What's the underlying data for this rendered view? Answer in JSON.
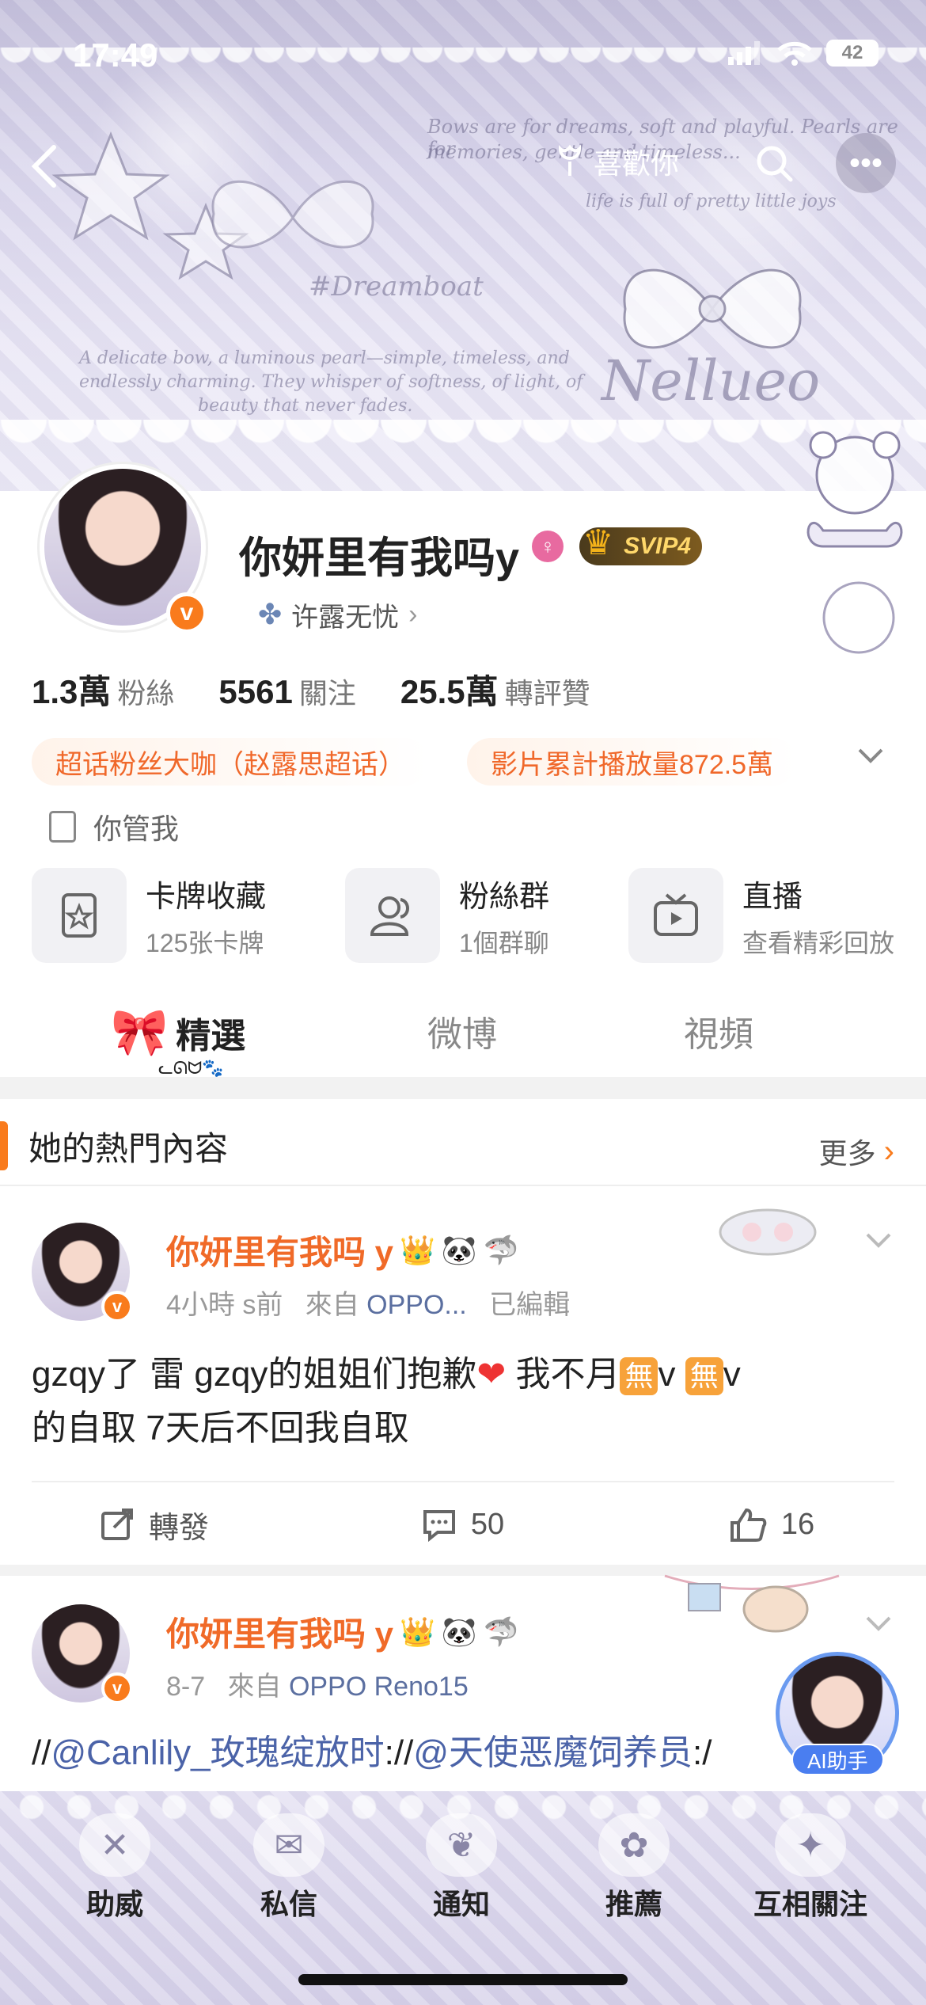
{
  "status_bar": {
    "time": "17:49",
    "battery": "42"
  },
  "header": {
    "like_label": "喜歡你",
    "deco_hashtag": "#Dreamboat",
    "deco_brand": "Nellueo",
    "deco_line1": "Bows are for dreams, soft and playful. Pearls are for",
    "deco_line2": "memories, gentle and timeless...",
    "deco_line3": "life is full of pretty little joys",
    "deco_line4": "A delicate bow, a luminous pearl—simple, timeless, and",
    "deco_line5": "endlessly charming. They whisper of softness, of light, of",
    "deco_line6": "beauty that never fades."
  },
  "profile": {
    "username": "你妍里有我吗y",
    "verified_badge": "v",
    "vip_label": "SVIP4",
    "fan_group": "许露无忧",
    "stats": [
      {
        "value": "1.3萬",
        "label": "粉絲"
      },
      {
        "value": "5561",
        "label": "關注"
      },
      {
        "value": "25.5萬",
        "label": "轉評贊"
      }
    ],
    "tags": [
      "超话粉丝大咖（赵露思超话）",
      "影片累計播放量872.5萬"
    ],
    "bio": "你管我",
    "entries": [
      {
        "title": "卡牌收藏",
        "sub": "125张卡牌",
        "icon": "card-icon"
      },
      {
        "title": "粉絲群",
        "sub": "1個群聊",
        "icon": "group-icon"
      },
      {
        "title": "直播",
        "sub": "查看精彩回放",
        "icon": "tv-icon"
      }
    ]
  },
  "tabs": [
    "精選",
    "微博",
    "視頻"
  ],
  "section": {
    "title": "她的熱門內容",
    "more": "更多"
  },
  "posts": [
    {
      "author": "你妍里有我吗 y",
      "time": "4小時 s前",
      "source_prefix": "來自",
      "source": "OPPO...",
      "edited": "已編輯",
      "text_part1": "gzqy了 雷 gzqy的姐姐们抱歉",
      "text_part2": " 我不月",
      "text_part3": "v ",
      "text_part4": "v",
      "text_line2": "的自取 7天后不回我自取",
      "wu": "無",
      "repost": "轉發",
      "comments": "50",
      "likes": "16"
    },
    {
      "author": "你妍里有我吗 y",
      "time": "8-7",
      "source_prefix": "來自",
      "source": "OPPO Reno15",
      "text_a": "//",
      "mention1": "@Canlily_玫瑰绽放时",
      "text_b": "://",
      "mention2": "@天使恶魔饲养员",
      "text_c": ":/"
    }
  ],
  "ai_assistant": "AI助手",
  "bottom_nav": [
    "助威",
    "私信",
    "通知",
    "推薦",
    "互相關注"
  ]
}
